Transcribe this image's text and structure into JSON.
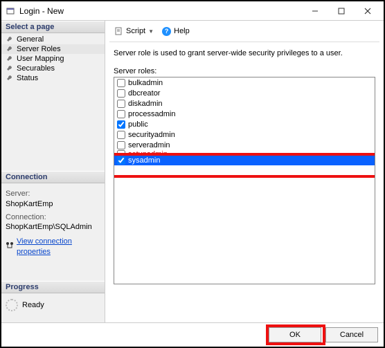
{
  "window": {
    "title": "Login - New"
  },
  "pages": {
    "header": "Select a page",
    "items": [
      {
        "label": "General",
        "selected": false
      },
      {
        "label": "Server Roles",
        "selected": true
      },
      {
        "label": "User Mapping",
        "selected": false
      },
      {
        "label": "Securables",
        "selected": false
      },
      {
        "label": "Status",
        "selected": false
      }
    ]
  },
  "connection": {
    "header": "Connection",
    "server_label": "Server:",
    "server_value": "ShopKartEmp",
    "conn_label": "Connection:",
    "conn_value": "ShopKartEmp\\SQLAdmin",
    "view_link": "View connection properties"
  },
  "progress": {
    "header": "Progress",
    "status": "Ready"
  },
  "toolbar": {
    "script": "Script",
    "help": "Help"
  },
  "main": {
    "info": "Server role is used to grant server-wide security privileges to a user.",
    "roles_label": "Server roles:"
  },
  "roles": [
    {
      "name": "bulkadmin",
      "checked": false,
      "selected": false
    },
    {
      "name": "dbcreator",
      "checked": false,
      "selected": false
    },
    {
      "name": "diskadmin",
      "checked": false,
      "selected": false
    },
    {
      "name": "processadmin",
      "checked": false,
      "selected": false
    },
    {
      "name": "public",
      "checked": true,
      "selected": false
    },
    {
      "name": "securityadmin",
      "checked": false,
      "selected": false
    },
    {
      "name": "serveradmin",
      "checked": false,
      "selected": false
    },
    {
      "name": "setupadmin",
      "checked": false,
      "selected": false,
      "cutoff": true
    },
    {
      "name": "sysadmin",
      "checked": true,
      "selected": true
    }
  ],
  "footer": {
    "ok": "OK",
    "cancel": "Cancel"
  }
}
